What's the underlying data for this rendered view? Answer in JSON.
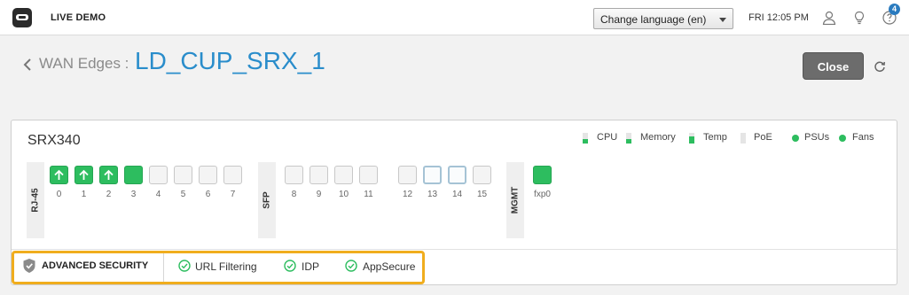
{
  "topbar": {
    "org_name": "LIVE DEMO",
    "language_select": "Change language (en)",
    "clock": "FRI 12:05 PM",
    "help_badge": "4",
    "icons": [
      "app-logo-icon",
      "user-icon",
      "lightbulb-icon",
      "help-icon"
    ]
  },
  "header": {
    "breadcrumb": "WAN Edges :",
    "device_name": "LD_CUP_SRX_1",
    "close_label": "Close"
  },
  "device": {
    "model": "SRX340",
    "legend": {
      "cpu": "CPU",
      "memory": "Memory",
      "temp": "Temp",
      "poe": "PoE",
      "psus": "PSUs",
      "fans": "Fans"
    },
    "status_color": "#2dbd5f",
    "groups": {
      "rj45": "RJ-45",
      "sfp": "SFP",
      "mgmt": "MGMT"
    },
    "rj45_ports": [
      {
        "label": "0",
        "state": "up-arrow"
      },
      {
        "label": "1",
        "state": "up-arrow"
      },
      {
        "label": "2",
        "state": "up-arrow"
      },
      {
        "label": "3",
        "state": "up"
      },
      {
        "label": "4",
        "state": "down"
      },
      {
        "label": "5",
        "state": "down"
      },
      {
        "label": "6",
        "state": "down"
      },
      {
        "label": "7",
        "state": "down"
      }
    ],
    "sfp_ports": [
      {
        "label": "8",
        "state": "down"
      },
      {
        "label": "9",
        "state": "down"
      },
      {
        "label": "10",
        "state": "down"
      },
      {
        "label": "11",
        "state": "down"
      },
      {
        "label": "12",
        "state": "down"
      },
      {
        "label": "13",
        "state": "sfp"
      },
      {
        "label": "14",
        "state": "sfp"
      },
      {
        "label": "15",
        "state": "down"
      }
    ],
    "mgmt_ports": [
      {
        "label": "fxp0",
        "state": "up"
      }
    ]
  },
  "security": {
    "title": "ADVANCED SECURITY",
    "highlight_color": "#f0ad1e",
    "features": [
      "URL Filtering",
      "IDP",
      "AppSecure"
    ]
  }
}
